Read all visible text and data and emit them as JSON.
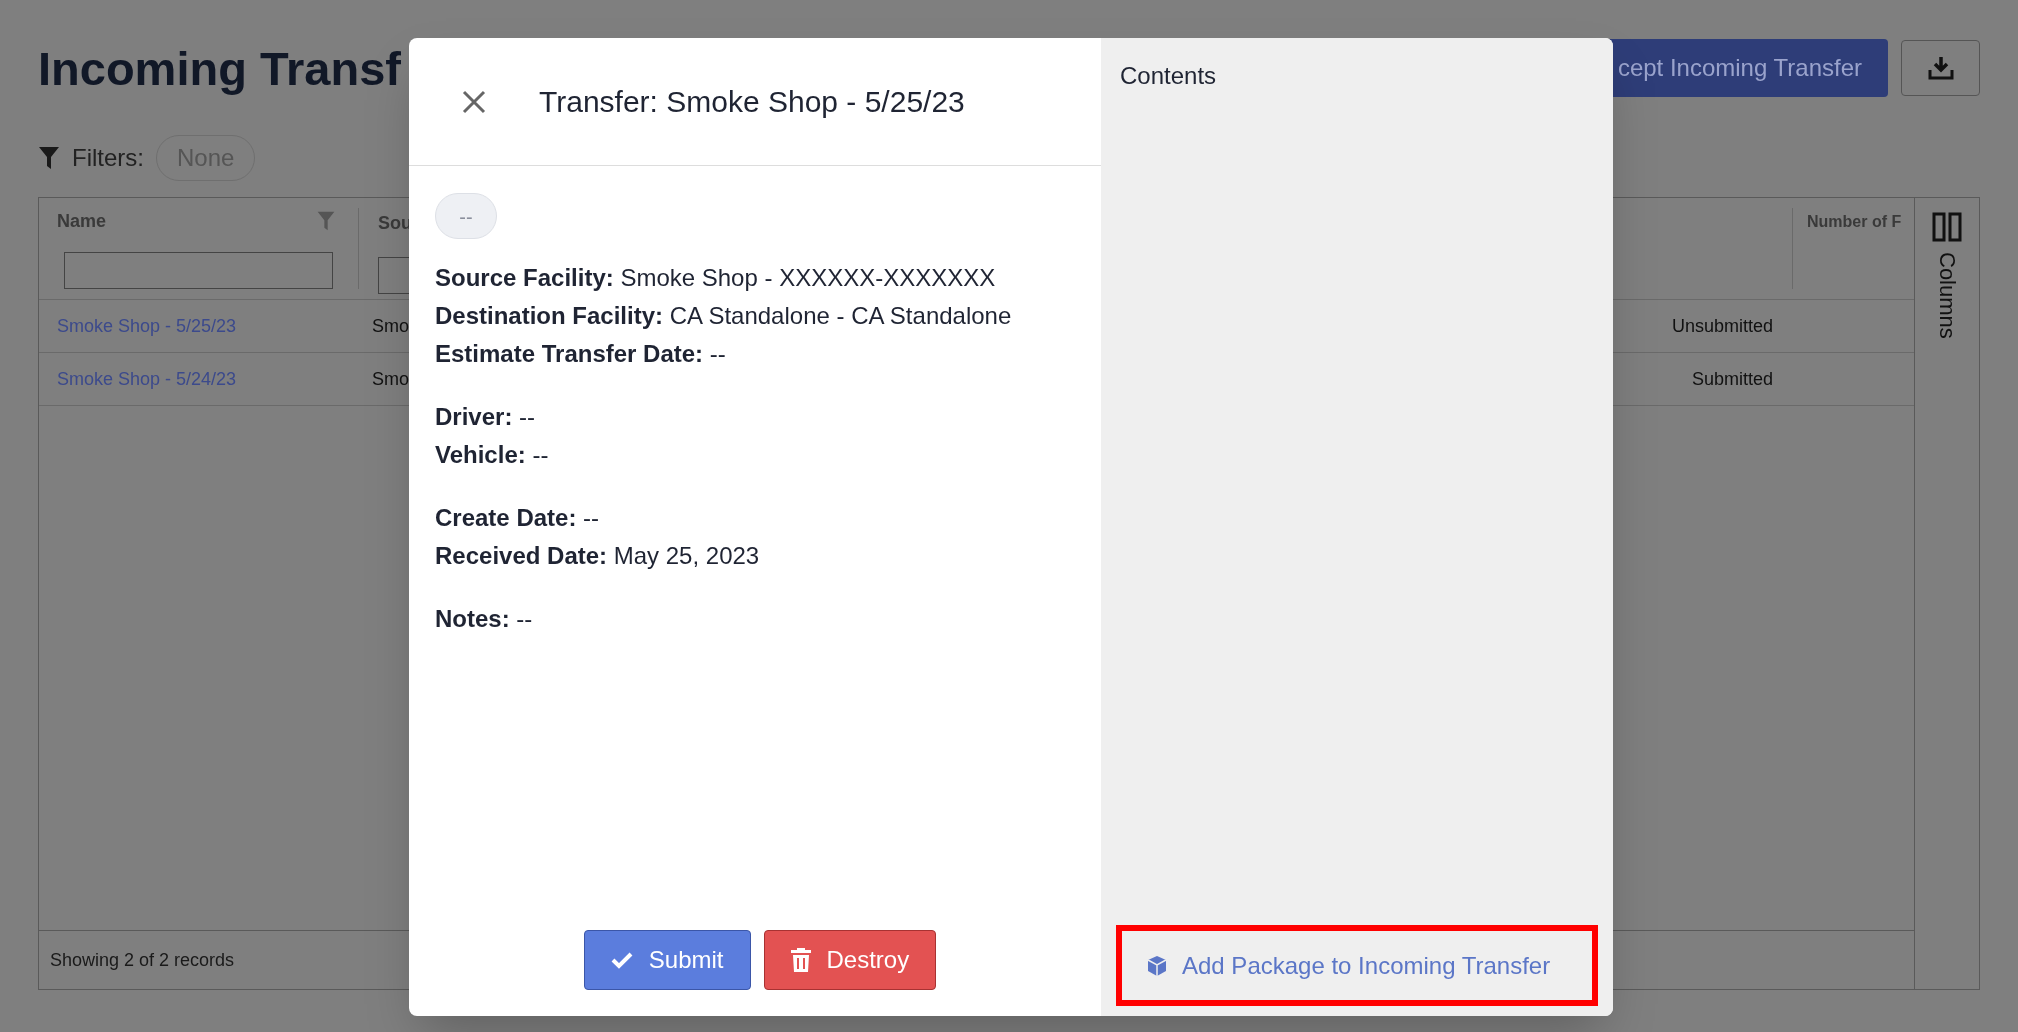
{
  "page": {
    "title": "Incoming Transf",
    "accept_button": "cept Incoming Transfer",
    "filters": {
      "label": "Filters:",
      "value": "None"
    }
  },
  "table": {
    "columns": [
      "Name",
      "Sou",
      "Number of F"
    ],
    "rows": [
      {
        "name": "Smoke Shop - 5/25/23",
        "column_2": "Smo",
        "status": "Unsubmitted"
      },
      {
        "name": "Smoke Shop - 5/24/23",
        "column_2": "Smo",
        "status": "Submitted"
      }
    ],
    "footer": "Showing 2 of 2 records",
    "columns_panel": "Columns"
  },
  "modal": {
    "title": "Transfer: Smoke Shop - 5/25/23",
    "badge": "--",
    "groups": [
      [
        "**Source Facility:** Smoke Shop - XXXXXX-XXXXXXX",
        "**Destination Facility:** CA Standalone - CA Standalone",
        "**Estimate Transfer Date:** --"
      ],
      [
        "**Driver:** --",
        "**Vehicle:** --"
      ],
      [
        "**Create Date:** --",
        "**Received Date:** May 25, 2023"
      ],
      [
        "**Notes:** --"
      ]
    ],
    "buttons": [
      {
        "label": "Submit",
        "kind": "submit"
      },
      {
        "label": "Destroy",
        "kind": "destroy"
      }
    ],
    "contents": {
      "title": "Contents",
      "add_link": "Add Package to Incoming Transfer"
    }
  }
}
